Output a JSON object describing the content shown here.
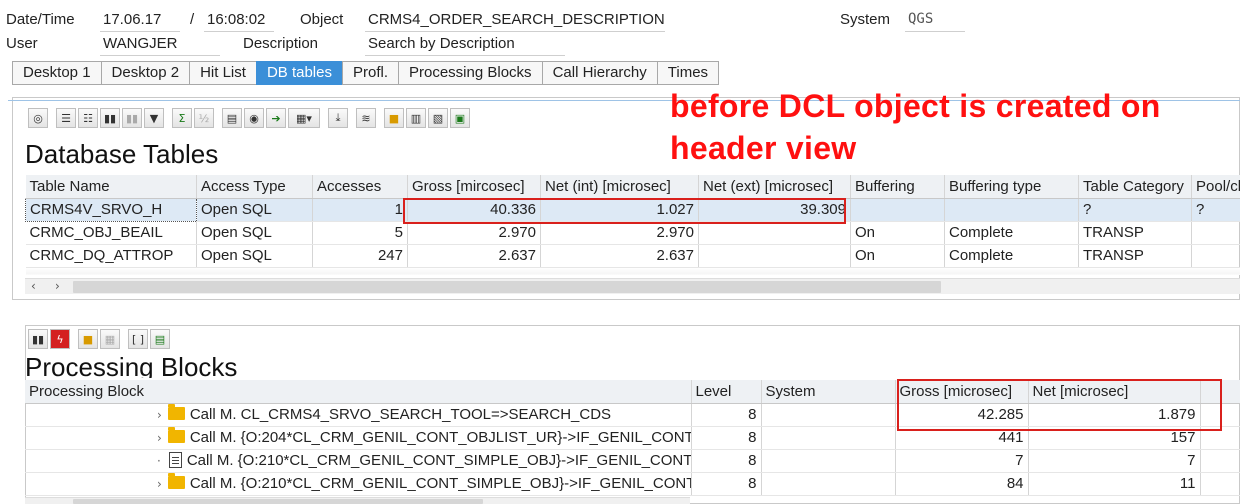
{
  "header": {
    "datetime_label": "Date/Time",
    "date": "17.06.17",
    "slash": "/",
    "time": "16:08:02",
    "object_label": "Object",
    "object_value": "CRMS4_ORDER_SEARCH_DESCRIPTION",
    "system_label": "System",
    "system_value": "QGS",
    "user_label": "User",
    "user_value": "WANGJER",
    "description_label": "Description",
    "description_value": "Search by Description"
  },
  "tabs": [
    {
      "label": "Desktop 1"
    },
    {
      "label": "Desktop 2"
    },
    {
      "label": "Hit List"
    },
    {
      "label": "DB tables",
      "active": true
    },
    {
      "label": "Profl."
    },
    {
      "label": "Processing Blocks"
    },
    {
      "label": "Call Hierarchy"
    },
    {
      "label": "Times"
    }
  ],
  "annotation": {
    "line1": "before DCL object is created on",
    "line2": "header view",
    "color": "#ff1010"
  },
  "db_tables": {
    "title": "Database Tables",
    "columns": [
      "Table Name",
      "Access Type",
      "Accesses",
      "Gross [mircosec]",
      "Net (int) [microsec]",
      "Net (ext) [microsec]",
      "Buffering",
      "Buffering type",
      "Table Category",
      "Pool/clu"
    ],
    "rows": [
      {
        "name": "CRMS4V_SRVO_H",
        "access": "Open SQL",
        "accesses": "1",
        "gross": "40.336",
        "net_int": "1.027",
        "net_ext": "39.309",
        "buffering": "",
        "buffering_type": "",
        "category": "?",
        "pool": "?"
      },
      {
        "name": "CRMC_OBJ_BEAIL",
        "access": "Open SQL",
        "accesses": "5",
        "gross": "2.970",
        "net_int": "2.970",
        "net_ext": "",
        "buffering": "On",
        "buffering_type": "Complete",
        "category": "TRANSP",
        "pool": ""
      },
      {
        "name": "CRMC_DQ_ATTROP",
        "access": "Open SQL",
        "accesses": "247",
        "gross": "2.637",
        "net_int": "2.637",
        "net_ext": "",
        "buffering": "On",
        "buffering_type": "Complete",
        "category": "TRANSP",
        "pool": ""
      }
    ]
  },
  "processing_blocks": {
    "title": "Processing Blocks",
    "columns": [
      "Processing Block",
      "Level",
      "System",
      "Gross [microsec]",
      "Net [microsec]"
    ],
    "rows": [
      {
        "icon": "folder-icon",
        "text": "Call M. CL_CRMS4_SRVO_SEARCH_TOOL=>SEARCH_CDS",
        "level": "8",
        "system": "",
        "gross": "42.285",
        "net": "1.879"
      },
      {
        "icon": "folder-icon",
        "text": "Call M. {O:204*CL_CRM_GENIL_CONT_OBJLIST_UR}->IF_GENIL_CONT",
        "level": "8",
        "system": "",
        "gross": "441",
        "net": "157"
      },
      {
        "icon": "document-icon",
        "text": "Call M. {O:210*CL_CRM_GENIL_CONT_SIMPLE_OBJ}->IF_GENIL_CONT",
        "level": "8",
        "system": "",
        "gross": "7",
        "net": "7"
      },
      {
        "icon": "folder-icon",
        "text": "Call M. {O:210*CL_CRM_GENIL_CONT_SIMPLE_OBJ}->IF_GENIL_CONT",
        "level": "8",
        "system": "",
        "gross": "84",
        "net": "11"
      }
    ]
  },
  "icons": {
    "toolbar_top": [
      "details-icon",
      "sort-asc-icon",
      "sort-desc-icon",
      "find-icon",
      "find-next-icon",
      "filter-icon",
      "sum-icon",
      "subtotal-icon",
      "print-icon",
      "print-preview-icon",
      "export-icon",
      "layout-icon",
      "download-icon",
      "database-icon",
      "choose-layout-icon",
      "save-layout-icon",
      "info-icon",
      "expand-icon"
    ],
    "toolbar_bottom": [
      "find-icon",
      "flash-icon",
      "hierarchy-icon",
      "table-icon",
      "bracket-icon",
      "list-icon"
    ]
  }
}
